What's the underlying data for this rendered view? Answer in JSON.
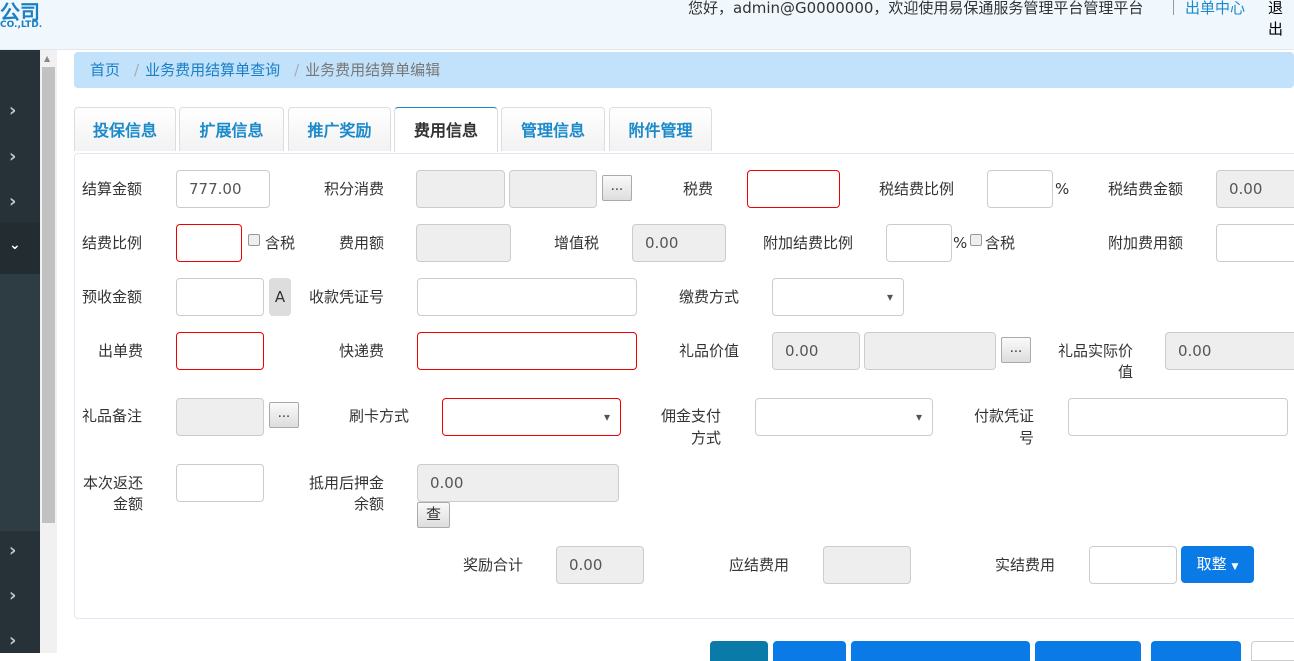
{
  "header": {
    "logo_text": "公司",
    "logo_sub": "CO.,LTD.",
    "greeting": "您好，admin@G0000000，欢迎使用易保通服务管理平台管理平台",
    "link_center": "出单中心",
    "logout": "退出"
  },
  "breadcrumb": [
    "首页",
    "业务费用结算单查询",
    "业务费用结算单编辑"
  ],
  "tabs": [
    "投保信息",
    "扩展信息",
    "推广奖励",
    "费用信息",
    "管理信息",
    "附件管理"
  ],
  "active_tab": "费用信息",
  "form": {
    "settle_amount": {
      "label": "结算金额",
      "value": "777.00"
    },
    "points": {
      "label": "积分消费",
      "button": "..."
    },
    "tax_fee": {
      "label": "税费"
    },
    "tax_ratio": {
      "label": "税结费比例",
      "unit": "%"
    },
    "tax_amount": {
      "label": "税结费金额",
      "value": "0.00"
    },
    "fee_ratio": {
      "label": "结费比例",
      "tax_incl": "含税"
    },
    "fee_amount": {
      "label": "费用额"
    },
    "vat": {
      "label": "增值税",
      "value": "0.00"
    },
    "extra_ratio": {
      "label": "附加结费比例",
      "unit": "%",
      "tax_incl": "含税"
    },
    "extra_amount": {
      "label": "附加费用额"
    },
    "prepaid": {
      "label": "预收金额",
      "button": "A"
    },
    "receipt_no": {
      "label": "收款凭证号"
    },
    "pay_method": {
      "label": "缴费方式"
    },
    "issue_fee": {
      "label": "出单费"
    },
    "express_fee": {
      "label": "快递费"
    },
    "gift_value": {
      "label": "礼品价值",
      "value": "0.00",
      "button": "..."
    },
    "gift_actual": {
      "label": "礼品实际价",
      "label2": "值",
      "value": "0.00"
    },
    "gift_note": {
      "label": "礼品备注",
      "button": "..."
    },
    "card_method": {
      "label": "刷卡方式"
    },
    "commission_method": {
      "label": "佣金支付",
      "label2": "方式"
    },
    "payment_no": {
      "label": "付款凭证",
      "label2": "号"
    },
    "return_amount": {
      "label": "本次返还",
      "label2": "金额"
    },
    "deposit_balance": {
      "label": "抵用后押金",
      "label2": "余额",
      "value": "0.00",
      "button": "查"
    },
    "reward_total": {
      "label": "奖励合计",
      "value": "0.00"
    },
    "due_fee": {
      "label": "应结费用"
    },
    "actual_fee": {
      "label": "实结费用",
      "button": "取整"
    }
  }
}
